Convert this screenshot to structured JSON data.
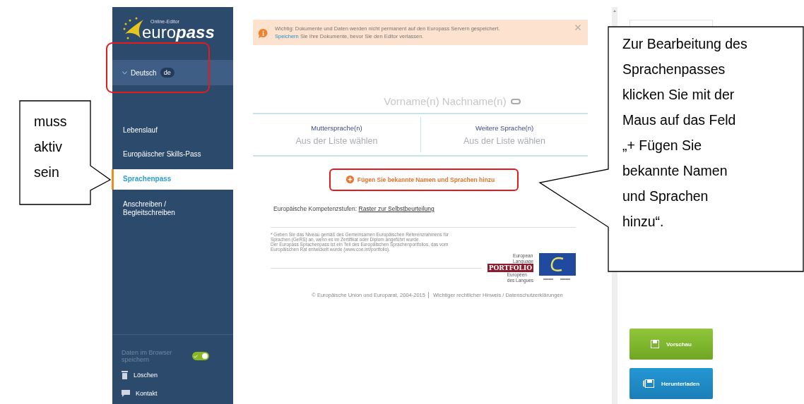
{
  "sidebar": {
    "logo": {
      "caption": "Online-Editor",
      "word_light": "euro",
      "word_bold": "pass"
    },
    "language": {
      "name": "Deutsch",
      "code": "de"
    },
    "nav_items": [
      {
        "lines": [
          "Lebenslauf"
        ],
        "selected": false
      },
      {
        "lines": [
          "Europäischer Skills-Pass"
        ],
        "selected": false
      },
      {
        "lines": [
          "Sprachenpass"
        ],
        "selected": true
      },
      {
        "lines": [
          "Anschreiben /",
          "Begleitschreiben"
        ],
        "selected": false
      }
    ],
    "browser_storage": {
      "lines": [
        "Daten im Browser",
        "speichern"
      ],
      "on": true
    },
    "actions": [
      {
        "kind": "delete",
        "label": "Löschen"
      },
      {
        "kind": "contact",
        "label": "Kontakt"
      }
    ]
  },
  "notice": {
    "text": "Wichtig: Dokumente und Daten werden nicht permanent auf den Europass Servern gespeichert.",
    "link": "Speichern",
    "rest": "Sie Ihre Dokumente, bevor Sie den Editor verlassen."
  },
  "name_placeholder": "Vorname(n) Nachname(n)",
  "languages": [
    {
      "heading": "Muttersprache(n)",
      "placeholder": "Aus der Liste wählen"
    },
    {
      "heading": "Weitere Sprache(n)",
      "placeholder": "Aus der Liste wählen"
    }
  ],
  "add_button": "Fügen Sie bekannte Namen und Sprachen hinzu",
  "levels": {
    "label": "Europäische Kompetenzstufen:",
    "link": "Raster zur Selbstbeurteilung"
  },
  "footnote": [
    "* Geben Sie das Niveau gemäß des Gemeinsamen Europäischen Referenzrahmens für",
    "Sprachen (GeRS) an, wenn es im Zertifikat oder Diplom angeführt wurde.",
    "Der Europass Sprachenpass ist ein Teil des Europäischen Sprachenportfolios, das vom",
    "Europäischen Rat entwickelt wurde (www.coe.int/portfolio)."
  ],
  "portfolio_logo": {
    "top": [
      "European",
      "Language"
    ],
    "word": "PORTFOLIO",
    "bottom": [
      "Européen",
      "des Langues"
    ]
  },
  "footer": {
    "copyright": "© Europäische Union und Europarat, 2004-2015",
    "link": "Wichtiger rechtlicher Hinweis / Datenschutzerklärungen"
  },
  "buttons": [
    {
      "kind": "preview",
      "label": "Vorschau"
    },
    {
      "kind": "download",
      "label": "Herunterladen"
    }
  ],
  "callouts": [
    {
      "lines": [
        "muss",
        "aktiv",
        "sein"
      ]
    },
    {
      "lines": [
        "Zur Bearbeitung des",
        "Sprachenpasses",
        "klicken Sie mit der",
        "Maus auf das Feld",
        "„+ Fügen Sie",
        "bekannte Namen",
        "und Sprachen",
        "hinzu“."
      ]
    }
  ]
}
